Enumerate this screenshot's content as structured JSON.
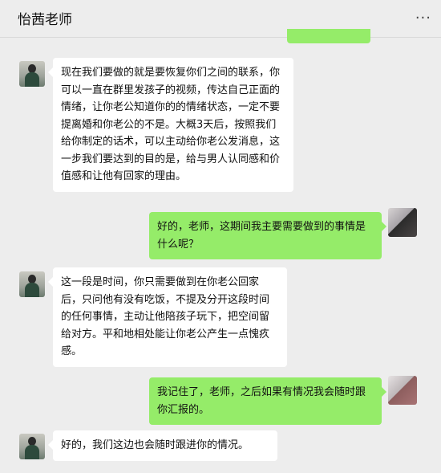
{
  "header": {
    "title": "怡茜老师",
    "more_icon": "more-dots-icon",
    "more_glyph": "···"
  },
  "messages": [
    {
      "side": "left",
      "text": "现在我们要做的就是要恢复你们之间的联系，你可以一直在群里发孩子的视频，传达自己正面的情绪，让你老公知道你的的情绪状态，一定不要提离婚和你老公的不是。大概3天后，按照我们给你制定的话术，可以主动给你老公发消息，这一步我们要达到的目的是，给与男人认同感和价值感和让他有回家的理由。"
    },
    {
      "side": "right",
      "text": "好的，老师，这期间我主要需要做到的事情是什么呢？"
    },
    {
      "side": "left",
      "text": "这一段是时间，你只需要做到在你老公回家后，只问他有没有吃饭，不提及分开这段时间的任何事情，主动让他陪孩子玩下，把空间留给对方。平和地相处能让你老公产生一点愧疚感。"
    },
    {
      "side": "right",
      "text": "我记住了，老师，之后如果有情况我会随时跟你汇报的。"
    },
    {
      "side": "left",
      "text": "好的，我们这边也会随时跟进你的情况。"
    }
  ],
  "colors": {
    "background": "#ededed",
    "bubble_left": "#ffffff",
    "bubble_right": "#95ec69"
  }
}
